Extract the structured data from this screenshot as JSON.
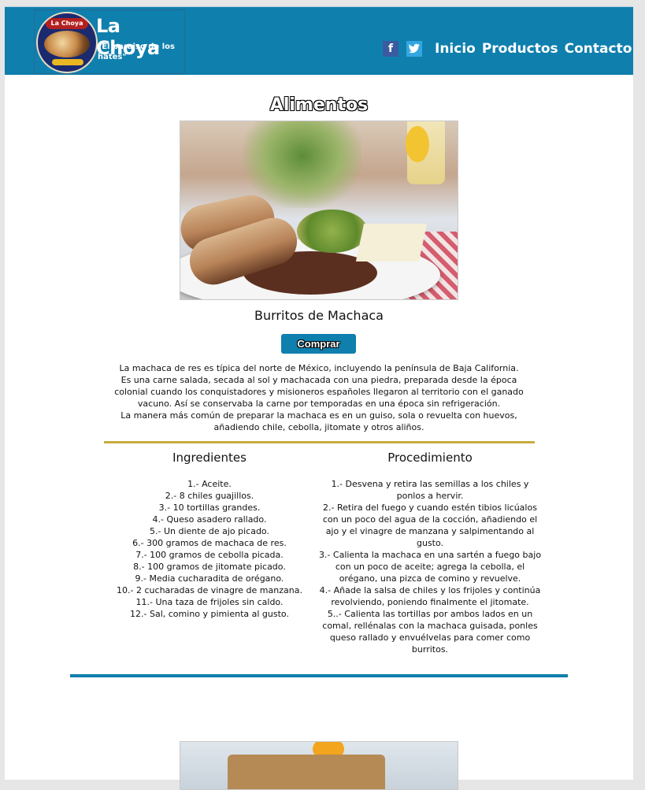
{
  "header": {
    "brand_name": "La Choya",
    "brand_tagline": "\"El paraiso de los hates\"",
    "logo_badge_text": "La Choya",
    "social": [
      {
        "name": "facebook-icon",
        "glyph": "f"
      },
      {
        "name": "twitter-icon",
        "glyph": "🐦"
      }
    ],
    "nav": [
      "Inicio",
      "Productos",
      "Contacto"
    ],
    "bg_color": "#0f7fae"
  },
  "main": {
    "section_title": "Alimentos",
    "dish_name": "Burritos de Machaca",
    "buy_label": "Comprar",
    "description": [
      "La machaca de res es típica del norte de México, incluyendo la península de Baja California.",
      "Es una carne salada, secada al sol y machacada con una piedra, preparada desde la época colonial cuando los conquistadores y misioneros españoles llegaron al territorio con el ganado vacuno. Así se conservaba la carne por temporadas en una época sin refrigeración.",
      "La manera más común de preparar la machaca es en un guiso, sola o revuelta con huevos, añadiendo chile, cebolla, jitomate y otros aliños."
    ],
    "ingredients_title": "Ingredientes",
    "ingredients": [
      "1.- Aceite.",
      "2.- 8 chiles guajillos.",
      "3.- 10 tortillas grandes.",
      "4.- Queso asadero rallado.",
      "5.- Un diente de ajo picado.",
      "6.- 300 gramos de machaca de res.",
      "7.- 100 gramos de cebolla picada.",
      "8.- 100 gramos de jitomate picado.",
      "9.- Media cucharadita de orégano.",
      "10.- 2 cucharadas de vinagre de manzana.",
      "11.- Una taza de frijoles sin caldo.",
      "12.- Sal, comino y pimienta al gusto."
    ],
    "procedure_title": "Procedimiento",
    "procedure": [
      "1.- Desvena y retira las semillas a los chiles y ponlos a hervir.",
      "2.- Retira del fuego y cuando estén tibios licúalos con un poco del agua de la cocción, añadiendo el ajo y el vinagre de manzana y salpimentando al gusto.",
      "3.- Calienta la machaca en una sartén a fuego bajo con un poco de aceite; agrega la cebolla, el orégano, una pizca de comino y revuelve.",
      "4.- Añade la salsa de chiles y los frijoles y continúa revolviendo, poniendo finalmente el jitomate.",
      "5..- Calienta las tortillas por ambos lados en un comal, rellénalas con la machaca guisada, ponles queso rallado y envuélvelas para comer como burritos."
    ],
    "accent_gold": "#c6ac3e",
    "accent_blue": "#0f7fae"
  }
}
